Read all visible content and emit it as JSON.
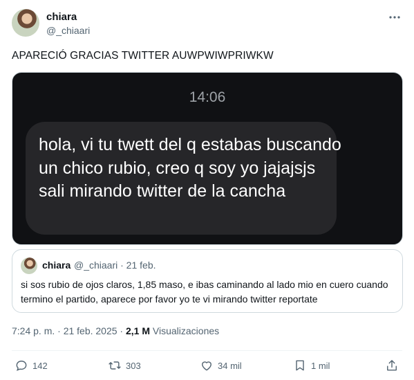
{
  "author": {
    "name": "chiara",
    "handle": "@_chiaari"
  },
  "tweet": {
    "text": "APARECIÓ GRACIAS TWITTER AUWPWIWPRIWKW"
  },
  "media": {
    "time": "14:06",
    "message": "hola, vi tu twett del q estabas buscando un chico rubio, creo q soy yo jajajsjs sali mirando twitter de la cancha"
  },
  "quote": {
    "name": "chiara",
    "meta": "@_chiaari · 21 feb.",
    "text": "si sos rubio de ojos claros, 1,85 maso, e ibas caminando al lado mio en cuero cuando termino el partido, aparece por favor yo te vi mirando twitter reportate"
  },
  "meta": {
    "timestamp": "7:24 p. m. · 21 feb. 2025 · ",
    "views_count": "2,1 M",
    "views_label": " Visualizaciones"
  },
  "actions": {
    "replies": "142",
    "reposts": "303",
    "likes": "34 mil",
    "bookmarks": "1 mil"
  },
  "icons": [
    "more-icon",
    "reply-icon",
    "repost-icon",
    "like-icon",
    "bookmark-icon",
    "share-icon"
  ]
}
